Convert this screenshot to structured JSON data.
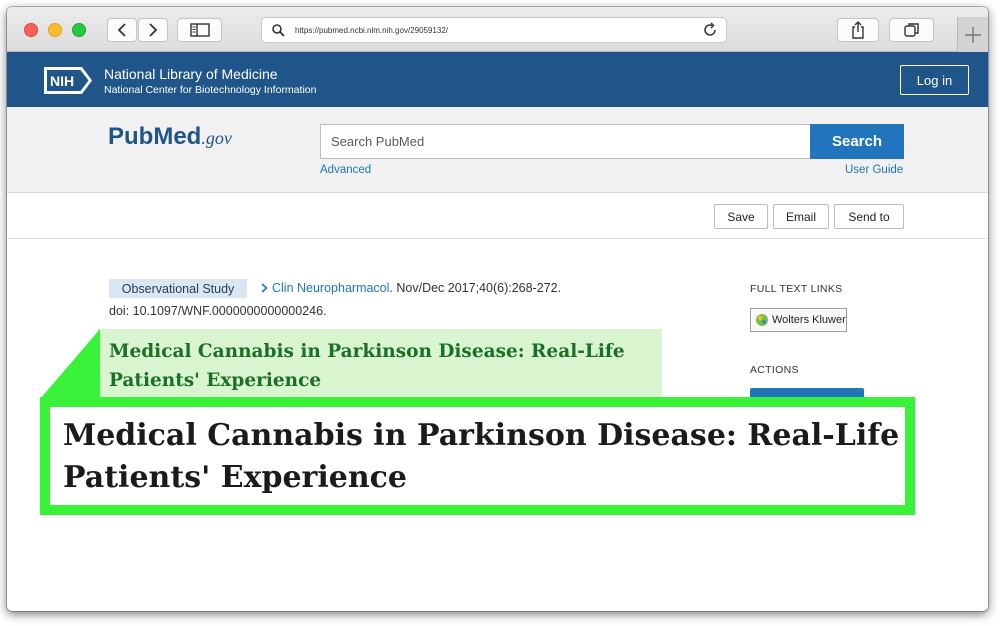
{
  "browser": {
    "url": "https://pubmed.ncbi.nlm.nih.gov/29059132/"
  },
  "header": {
    "nih_badge": "NIH",
    "title": "National Library of Medicine",
    "subtitle": "National Center for Biotechnology Information",
    "login_label": "Log in"
  },
  "search": {
    "logo_pub": "Pub",
    "logo_med": "Med",
    "logo_gov": ".gov",
    "placeholder": "Search PubMed",
    "button_label": "Search",
    "advanced_label": "Advanced",
    "user_guide_label": "User Guide"
  },
  "actions_row": {
    "save_label": "Save",
    "email_label": "Email",
    "send_to_label": "Send to"
  },
  "article": {
    "study_type": "Observational Study",
    "journal": "Clin Neuropharmacol",
    "citation": ". Nov/Dec 2017;40(6):268-272.",
    "doi": "doi: 10.1097/WNF.0000000000000246.",
    "title_line1": "Medical Cannabis in Parkinson Disease: Real-Life",
    "title_line2": "Patients' Experience"
  },
  "sidebar": {
    "full_text_links_label": "FULL TEXT LINKS",
    "publisher_label": "Wolters Kluwer",
    "actions_label": "ACTIONS"
  },
  "colors": {
    "nih_blue": "#20558a",
    "link_blue": "#2075bd",
    "highlight_green": "#3bf23b",
    "title_green": "#1d6e29"
  }
}
